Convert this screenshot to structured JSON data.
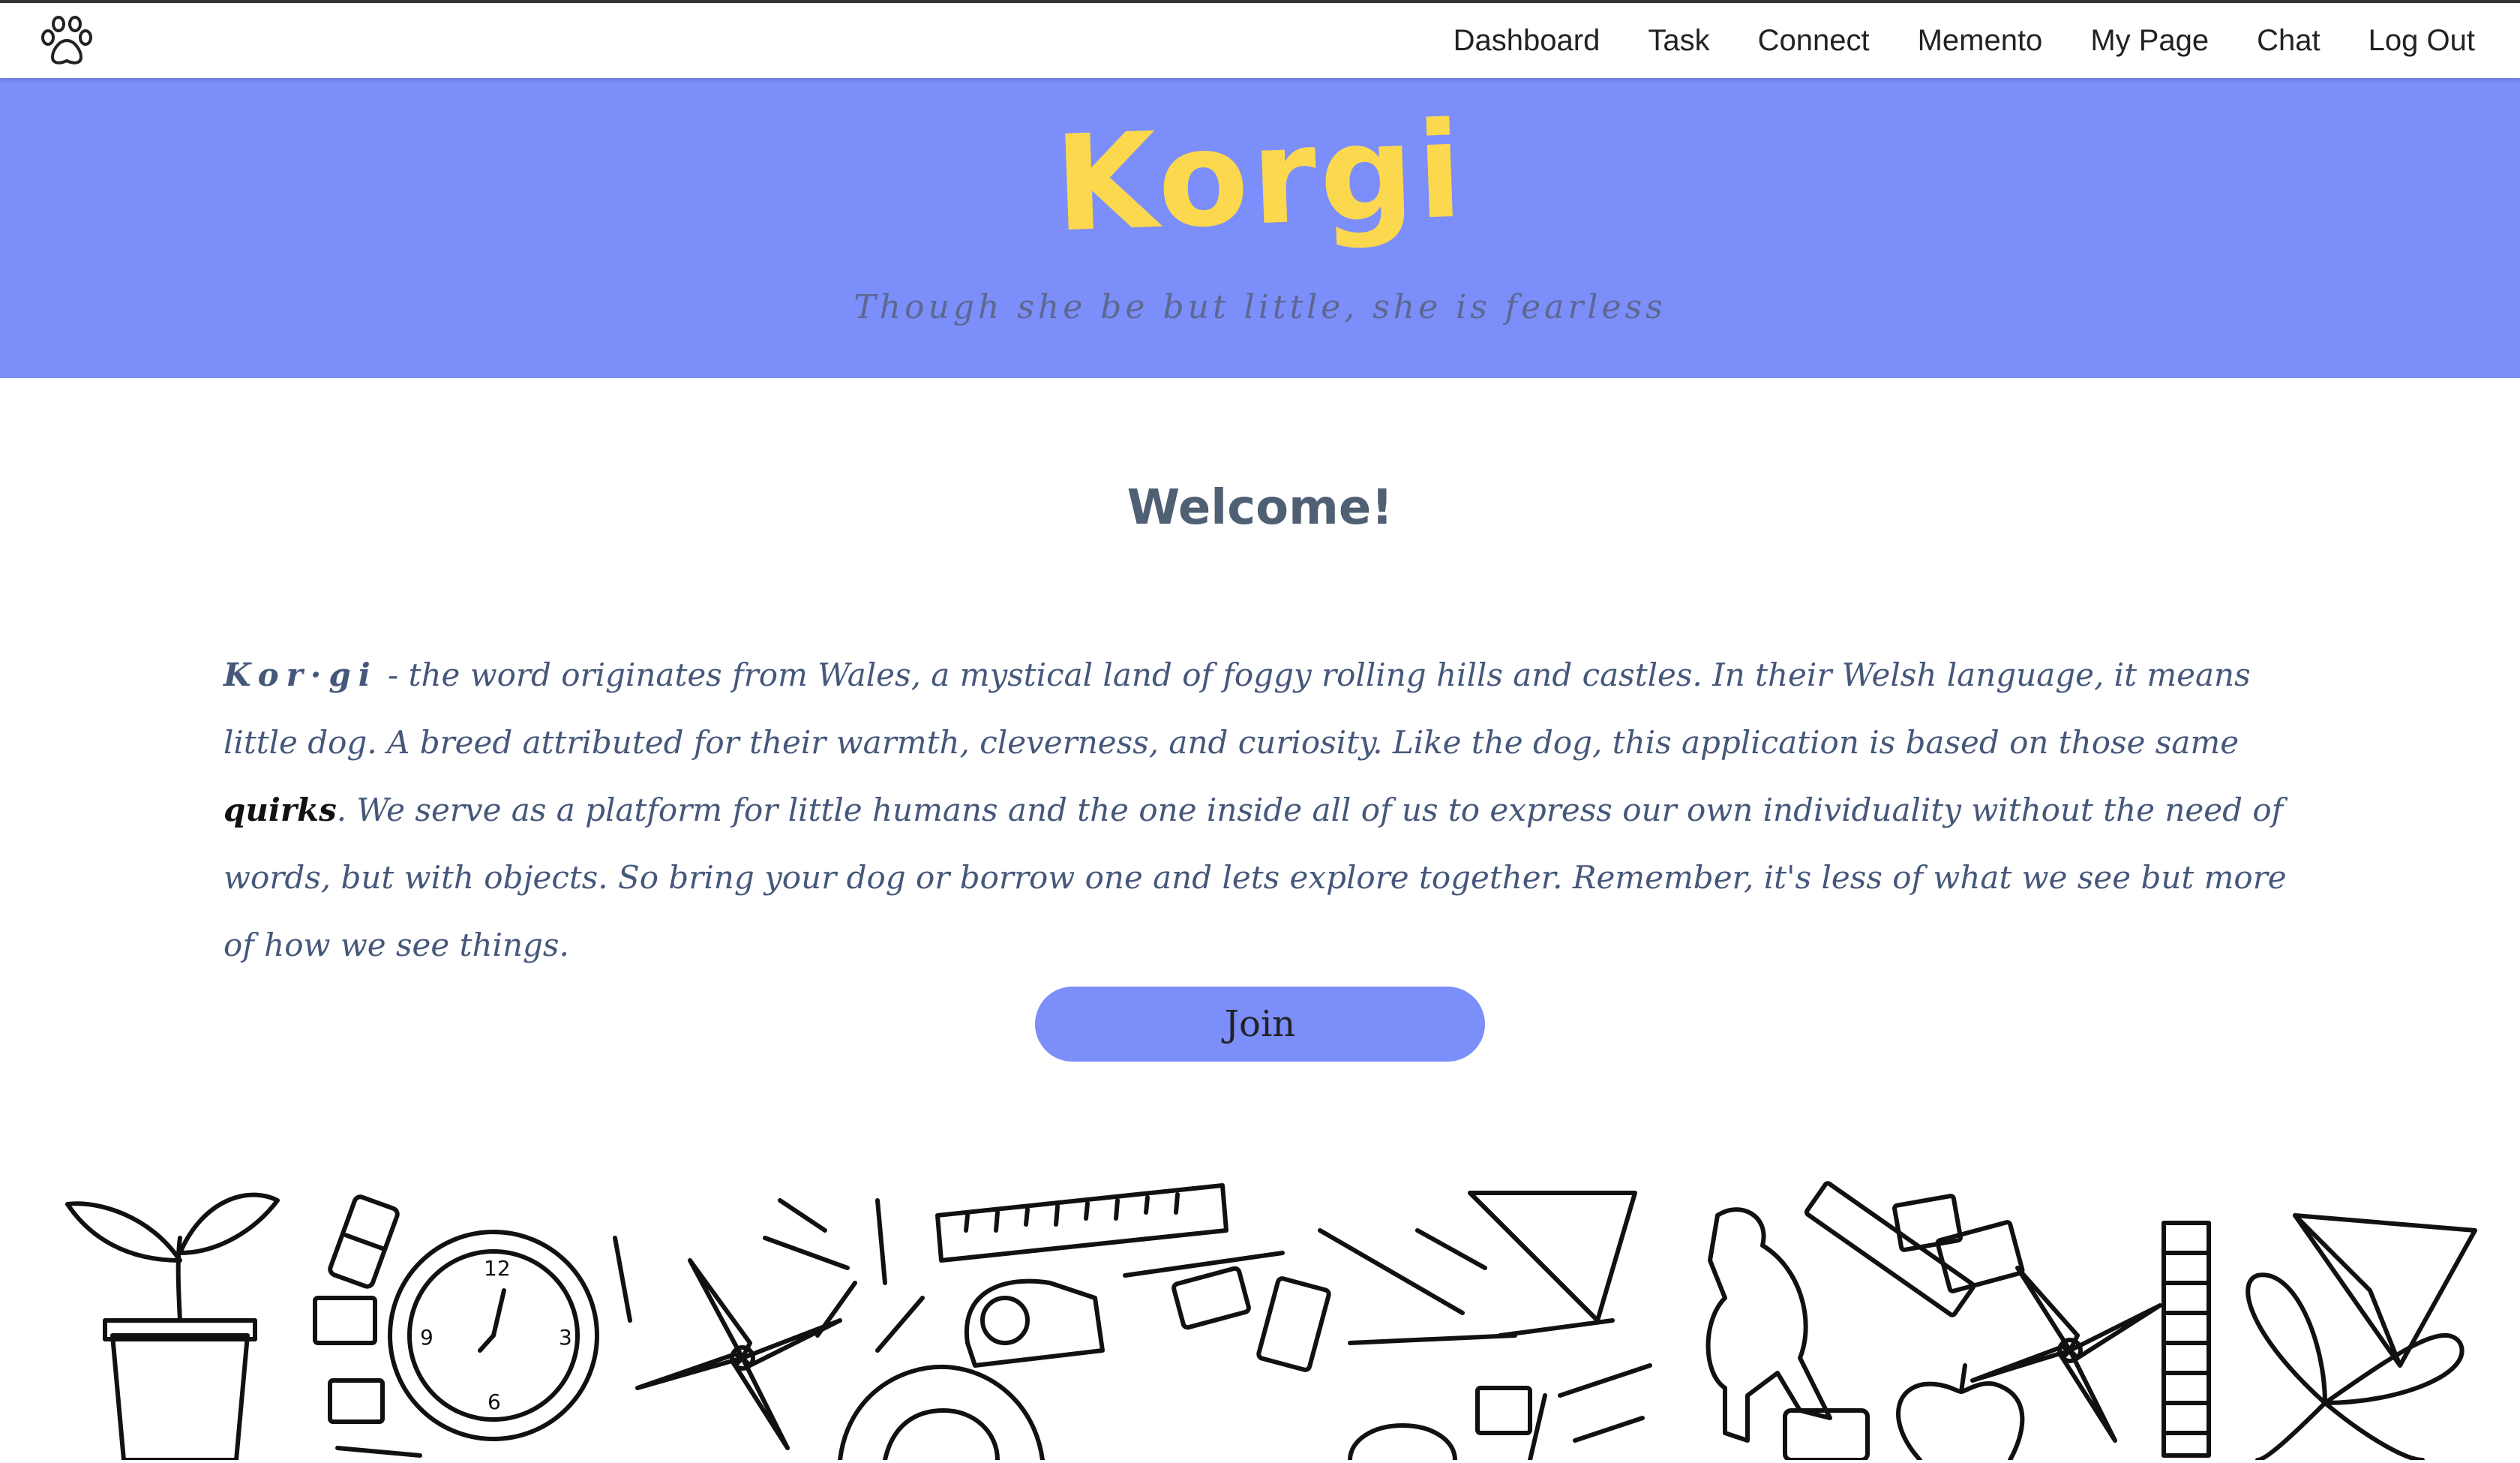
{
  "nav": {
    "logo_icon": "paw-print-icon",
    "links": [
      "Dashboard",
      "Task",
      "Connect",
      "Memento",
      "My Page",
      "Chat",
      "Log Out"
    ]
  },
  "hero": {
    "brand": "Korgi",
    "tagline": "Though she be but little, she is fearless"
  },
  "main": {
    "welcome": "Welcome!",
    "intro": {
      "word": "Kor·gi",
      "part1": " - the word originates from Wales, a mystical land of foggy rolling hills and castles. In their Welsh language, it means little dog. A breed attributed for their warmth, cleverness, and curiosity. Like the dog, this application is based on those same ",
      "highlight": "quirks",
      "part2": ". We serve as a platform for little humans and the one inside all of us to express our own individuality without the need of words, but with objects. So bring your dog or borrow one and lets explore together. Remember, it's less of what we see but more of how we see things."
    },
    "join_label": "Join"
  },
  "colors": {
    "hero_bg": "#7b8ef9",
    "brand": "#fbd84e",
    "text": "#45577a",
    "button": "#7b8ef9"
  },
  "footer": {
    "illustration": "hand-drawn toys and school supplies doodle"
  }
}
